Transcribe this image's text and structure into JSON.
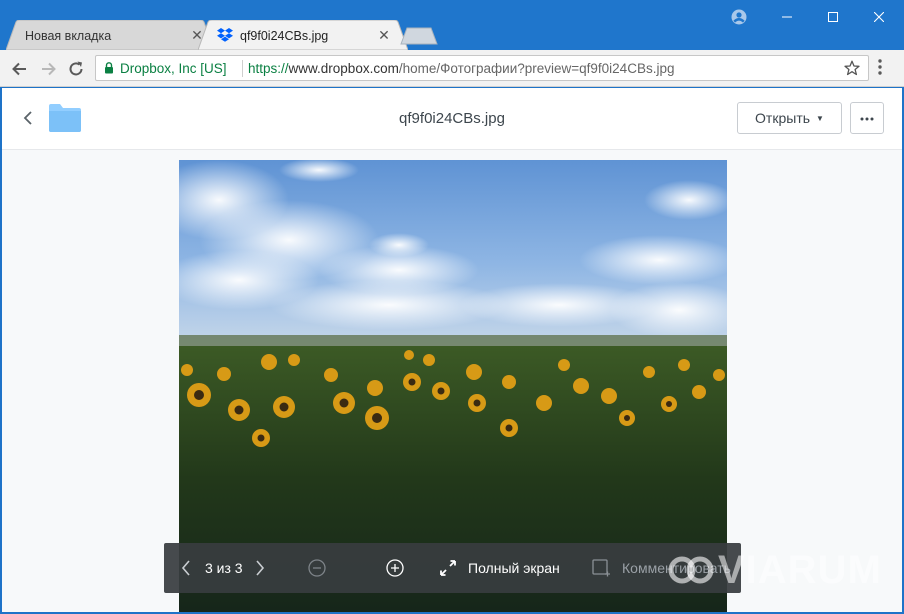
{
  "browser": {
    "tabs": [
      {
        "title": "Новая вкладка",
        "active": false
      },
      {
        "title": "qf9f0i24CBs.jpg",
        "active": true
      }
    ],
    "omnibox": {
      "site_identity": "Dropbox, Inc [US]",
      "url_scheme": "https://",
      "url_host": "www.dropbox.com",
      "url_path": "/home/Фотографии?preview=qf9f0i24CBs.jpg"
    },
    "colors": {
      "titlebar": "#1f76cc",
      "secure_green": "#0b8043"
    }
  },
  "viewer": {
    "file_name": "qf9f0i24CBs.jpg",
    "open_label": "Открыть",
    "controls": {
      "page_counter": "3 из 3",
      "fullscreen_label": "Полный экран",
      "comment_label": "Комментировать"
    }
  },
  "watermark": "VIARUM"
}
